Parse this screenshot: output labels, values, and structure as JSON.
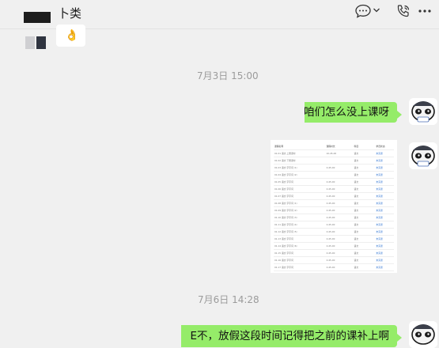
{
  "header": {
    "title": "卜类",
    "chat_icon": "chat-bubble-icon",
    "chevron_icon": "chevron-down-icon",
    "call_icon": "phone-call-icon",
    "more_icon": "more-icon"
  },
  "messages": {
    "emoji_message": "👌",
    "timestamp_1": "7月3日 15:00",
    "msg_1": "咱们怎么没上课呀",
    "image_table": {
      "headers": [
        "课程名称",
        "课程时长",
        "科目",
        "学员状态"
      ],
      "rows": [
        [
          "01.01 语文 上册课时",
          "10-45-00",
          "语文",
          "未完课"
        ],
        [
          "01.02 语文 下册课时",
          "",
          "语文",
          "未完课"
        ],
        [
          "01.03 语文 字字词 (1)",
          "X-45-00",
          "语文",
          "未完课"
        ],
        [
          "01.04 语文 字字词 (2)",
          "",
          "语文",
          "未完课"
        ],
        [
          "01.05 语文 字字词",
          "X-45-00",
          "语文",
          "未完课"
        ],
        [
          "01.06 语文 字字词",
          "X-45-00",
          "语文",
          "未完课"
        ],
        [
          "01.07 语文 字字词",
          "X-45-00",
          "语文",
          "未完课"
        ],
        [
          "01.08 语文 字字词 (1)",
          "X-45-00",
          "语文",
          "未完课"
        ],
        [
          "01.09 语文 字字词 (2)",
          "X-45-00",
          "语文",
          "未完课"
        ],
        [
          "01.10 语文 字字词 (3)",
          "X-45-00",
          "语文",
          "未完课"
        ],
        [
          "01.11 语文 字字词 (4)",
          "X-45-00",
          "语文",
          "未完课"
        ],
        [
          "01.12 语文 字字词 (5)",
          "X-45-00",
          "语文",
          "未完课"
        ],
        [
          "01.13 语文 字字词",
          "X-45-00",
          "语文",
          "未完课"
        ],
        [
          "01.14 语文 字字词 (6)",
          "X-45-00",
          "语文",
          "未完课"
        ],
        [
          "01.15 语文 字字词",
          "X-45-00",
          "语文",
          "未完课"
        ],
        [
          "01.16 语文 字字词",
          "X-45-00",
          "语文",
          "未完课"
        ],
        [
          "01.17 语文 字字词",
          "X-45-00",
          "语文",
          "未完课"
        ],
        [
          "01.18 语文 字字词 (7)",
          "X-45-00",
          "语文",
          "未完课"
        ]
      ]
    },
    "timestamp_2": "7月6日 14:28",
    "msg_2": "E不，放假这段时间记得把之前的课补上啊"
  },
  "colors": {
    "background": "#f0f0f0",
    "bubble_sent": "#95ec69",
    "bubble_received": "#ffffff",
    "timestamp": "#9b9b9b"
  }
}
